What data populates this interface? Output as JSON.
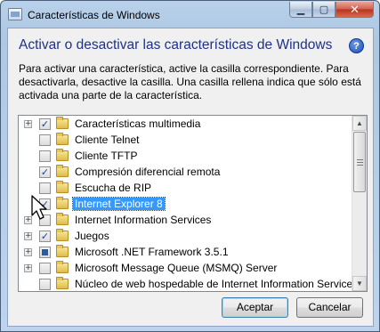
{
  "window": {
    "title": "Características de Windows",
    "caption_buttons": {
      "minimize": "▁",
      "maximize": "▢",
      "close": "✕"
    }
  },
  "heading": "Activar o desactivar las características de Windows",
  "help_icon_label": "?",
  "description": "Para activar una característica, active la casilla correspondiente. Para desactivarla, desactive la casilla. Una casilla rellena indica que sólo está activada una parte de la característica.",
  "features": [
    {
      "label": "Características multimedia",
      "expandable": true,
      "state": "checked",
      "selected": false
    },
    {
      "label": "Cliente Telnet",
      "expandable": false,
      "state": "unchecked",
      "selected": false
    },
    {
      "label": "Cliente TFTP",
      "expandable": false,
      "state": "unchecked",
      "selected": false
    },
    {
      "label": "Compresión diferencial remota",
      "expandable": false,
      "state": "checked",
      "selected": false
    },
    {
      "label": "Escucha de RIP",
      "expandable": false,
      "state": "unchecked",
      "selected": false
    },
    {
      "label": "Internet Explorer 8",
      "expandable": false,
      "state": "checked",
      "selected": true
    },
    {
      "label": "Internet Information Services",
      "expandable": true,
      "state": "unchecked",
      "selected": false
    },
    {
      "label": "Juegos",
      "expandable": true,
      "state": "checked",
      "selected": false
    },
    {
      "label": "Microsoft .NET Framework 3.5.1",
      "expandable": true,
      "state": "partial",
      "selected": false
    },
    {
      "label": "Microsoft Message Queue (MSMQ) Server",
      "expandable": true,
      "state": "unchecked",
      "selected": false
    },
    {
      "label": "Núcleo de web hospedable de Internet Information Services",
      "expandable": false,
      "state": "unchecked",
      "selected": false
    }
  ],
  "expander_glyph": "+",
  "check_glyph": "✓",
  "scrollbar": {
    "up_glyph": "▲",
    "down_glyph": "▼"
  },
  "buttons": {
    "ok": "Aceptar",
    "cancel": "Cancelar"
  },
  "colors": {
    "heading": "#1e3287",
    "selection": "#3399ff"
  }
}
